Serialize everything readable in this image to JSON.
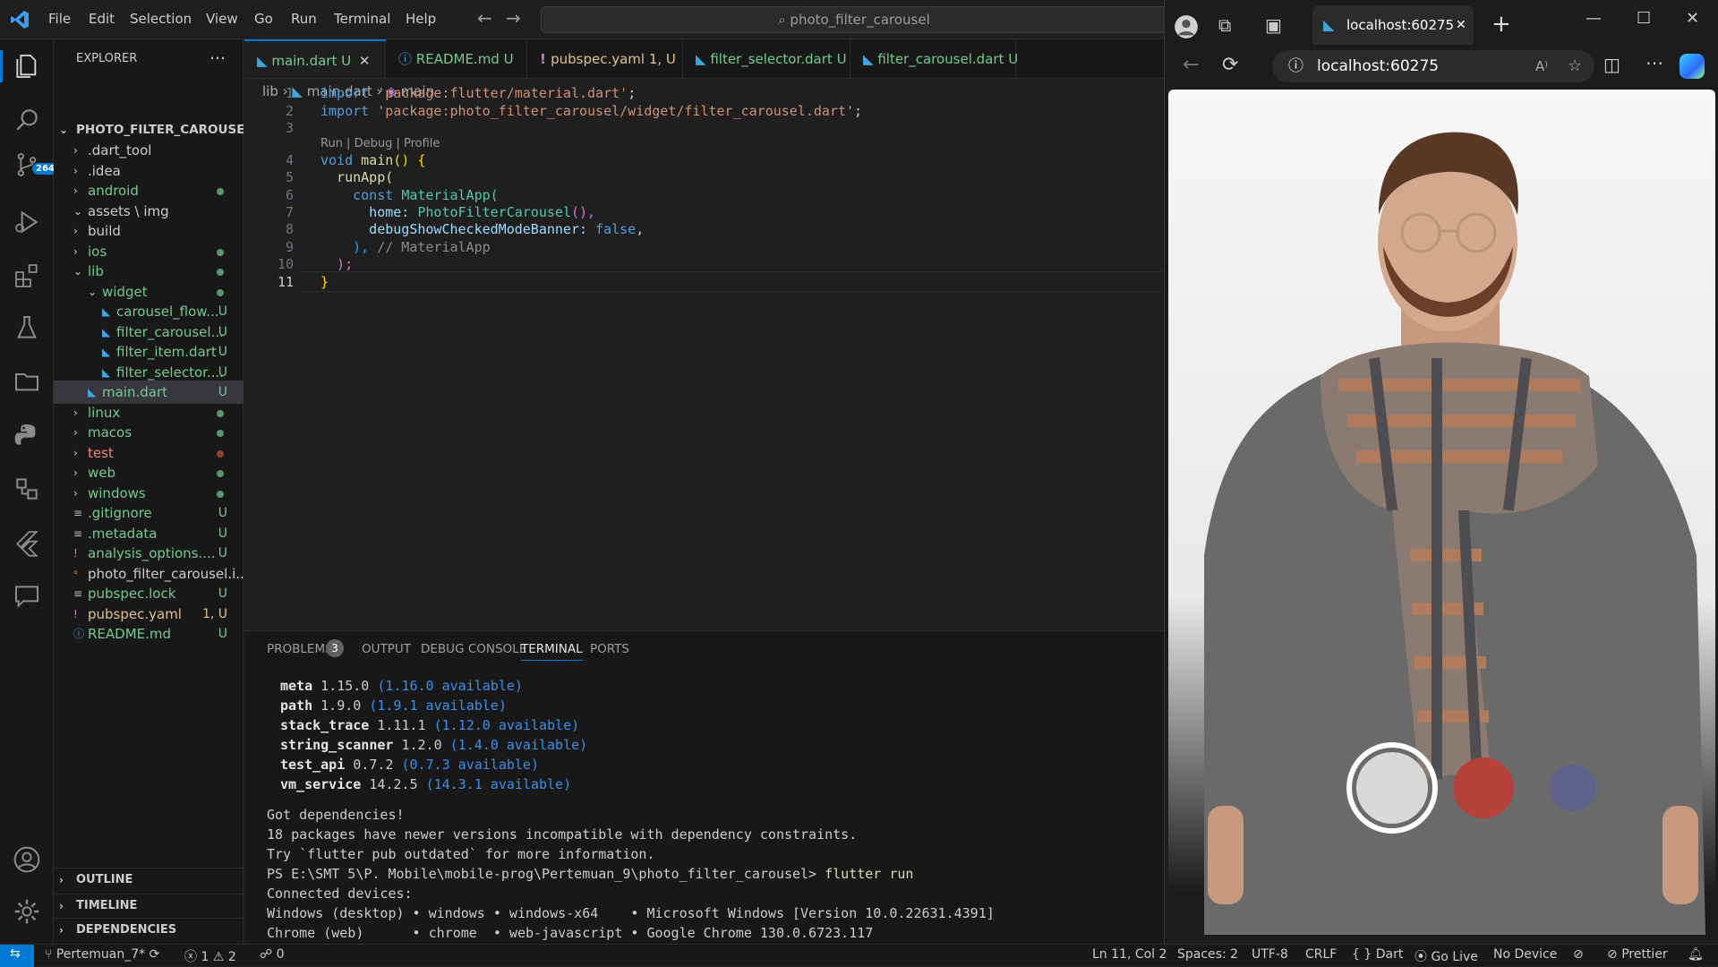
{
  "menu": [
    "File",
    "Edit",
    "Selection",
    "View",
    "Go",
    "Run",
    "Terminal",
    "Help"
  ],
  "command_center": "photo_filter_carousel",
  "activity": {
    "scm_badge": "264"
  },
  "explorer": {
    "title": "EXPLORER",
    "more": "…",
    "root": "PHOTO_FILTER_CAROUSEL",
    "items": [
      {
        "label": ".dart_tool",
        "status": ""
      },
      {
        "label": ".idea",
        "status": ""
      },
      {
        "label": "android",
        "status": "dot"
      },
      {
        "label": "assets \\ img",
        "status": ""
      },
      {
        "label": "build",
        "status": ""
      },
      {
        "label": "ios",
        "status": "dot"
      },
      {
        "label": "lib",
        "status": "dot"
      },
      {
        "label": "widget",
        "status": "dot"
      },
      {
        "label": "carousel_flow...",
        "status": "U"
      },
      {
        "label": "filter_carousel...",
        "status": "U"
      },
      {
        "label": "filter_item.dart",
        "status": "U"
      },
      {
        "label": "filter_selector....",
        "status": "U"
      },
      {
        "label": "main.dart",
        "status": "U"
      },
      {
        "label": "linux",
        "status": "dot"
      },
      {
        "label": "macos",
        "status": "dot"
      },
      {
        "label": "test",
        "status": "dot-red"
      },
      {
        "label": "web",
        "status": "dot"
      },
      {
        "label": "windows",
        "status": "dot"
      },
      {
        "label": ".gitignore",
        "status": "U"
      },
      {
        "label": ".metadata",
        "status": "U"
      },
      {
        "label": "analysis_options....",
        "status": "U"
      },
      {
        "label": "photo_filter_carousel.i...",
        "status": ""
      },
      {
        "label": "pubspec.lock",
        "status": "U"
      },
      {
        "label": "pubspec.yaml",
        "status": "1, U"
      },
      {
        "label": "README.md",
        "status": "U"
      }
    ],
    "sections": [
      "OUTLINE",
      "TIMELINE",
      "DEPENDENCIES"
    ]
  },
  "tabs": [
    {
      "label": "main.dart",
      "status": "U"
    },
    {
      "label": "README.md",
      "status": "U"
    },
    {
      "label": "pubspec.yaml",
      "status": "1, U"
    },
    {
      "label": "filter_selector.dart",
      "status": "U"
    },
    {
      "label": "filter_carousel.dart",
      "status": "U"
    }
  ],
  "breadcrumb": {
    "folder": "lib",
    "file": "main.dart",
    "symbol": "main"
  },
  "codelens": "Run | Debug | Profile",
  "code": {
    "lines": [
      "1",
      "2",
      "3",
      "4",
      "5",
      "6",
      "7",
      "8",
      "9",
      "10",
      "11"
    ],
    "l1a": "import ",
    "l1b": "'package:flutter/material.dart'",
    "l1c": ";",
    "l2a": "import ",
    "l2b": "'package:photo_filter_carousel/widget/filter_carousel.dart'",
    "l2c": ";",
    "l4a": "void ",
    "l4b": "main",
    "l4c": "() {",
    "l5a": "  runApp(",
    "l6a": "    const ",
    "l6b": "MaterialApp(",
    "l7a": "      home: ",
    "l7b": "PhotoFilterCarousel",
    "l7c": "(),",
    "l8a": "      debugShowCheckedModeBanner: ",
    "l8b": "false",
    ",l8c": ",",
    "l9a": "    ), ",
    "l9b": "// MaterialApp",
    "l10a": "  );",
    "l11a": "}"
  },
  "panel": {
    "tabs": [
      "PROBLEMS",
      "OUTPUT",
      "DEBUG CONSOLE",
      "TERMINAL",
      "PORTS"
    ],
    "problems_count": "3",
    "pkgs": [
      {
        "name": "meta",
        "ver": "1.15.0",
        "avail": "(1.16.0 available)"
      },
      {
        "name": "path",
        "ver": "1.9.0",
        "avail": "(1.9.1 available)"
      },
      {
        "name": "stack_trace",
        "ver": "1.11.1",
        "avail": "(1.12.0 available)"
      },
      {
        "name": "string_scanner",
        "ver": "1.2.0",
        "avail": "(1.4.0 available)"
      },
      {
        "name": "test_api",
        "ver": "0.7.2",
        "avail": "(0.7.3 available)"
      },
      {
        "name": "vm_service",
        "ver": "14.2.5",
        "avail": "(14.3.1 available)"
      }
    ],
    "t1": "Got dependencies!",
    "t2": "18 packages have newer versions incompatible with dependency constraints.",
    "t3": "Try `flutter pub outdated` for more information.",
    "prompt": "PS E:\\SMT 5\\P. Mobile\\mobile-prog\\Pertemuan_9\\photo_filter_carousel> ",
    "cmd": "flutter run",
    "t5": "Connected devices:",
    "t6": "Windows (desktop) • windows • windows-x64    • Microsoft Windows [Version 10.0.22631.4391]",
    "t7": "Chrome (web)      • chrome  • web-javascript • Google Chrome 130.0.6723.117"
  },
  "status": {
    "branch": "Pertemuan_7*",
    "errors": "1",
    "warnings": "2",
    "ports": "0",
    "position": "Ln 11, Col 2",
    "spaces": "Spaces: 2",
    "encoding": "UTF-8",
    "eol": "CRLF",
    "lang": "Dart",
    "golive": "Go Live",
    "device": "No Device",
    "prettier": "Prettier"
  },
  "browser": {
    "tab_title": "localhost:60275",
    "url": "localhost:60275"
  },
  "colors": {
    "accent": "#0078d4",
    "git_untracked": "#73c991",
    "keyword": "#569cd6",
    "string": "#ce9178",
    "func": "#dcdcaa",
    "type": "#4ec9b0",
    "prop": "#9cdcfe",
    "comment": "#6a9955"
  }
}
